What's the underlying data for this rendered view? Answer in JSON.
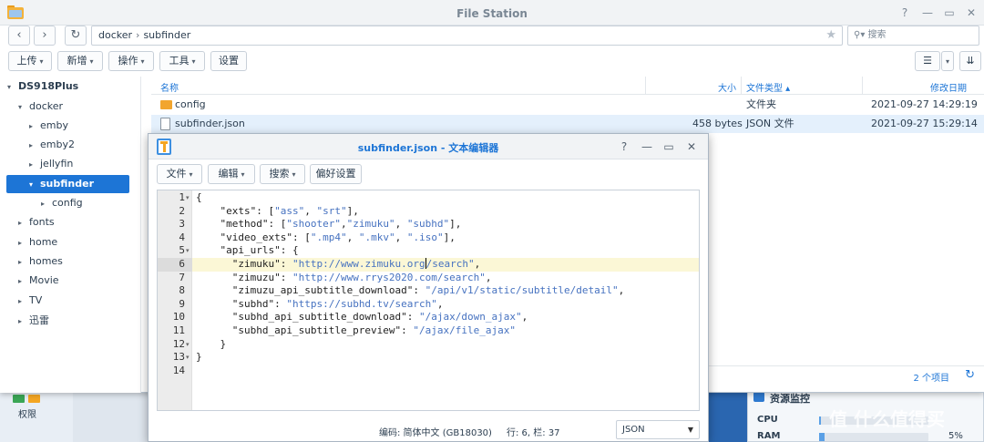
{
  "desktop": {
    "permission_label": "权限",
    "widget_title": "资源监控",
    "cpu_label": "CPU",
    "ram_label": "RAM",
    "cpu_percent": 2,
    "ram_percent": "5%",
    "ram_fill": 5,
    "watermark": "值 什么值得买"
  },
  "file_station": {
    "title": "File Station",
    "path": [
      "docker",
      "subfinder"
    ],
    "search_placeholder": "搜索",
    "toolbar": [
      {
        "label": "上传",
        "dropdown": true
      },
      {
        "label": "新增",
        "dropdown": true
      },
      {
        "label": "操作",
        "dropdown": true
      },
      {
        "label": "工具",
        "dropdown": true
      },
      {
        "label": "设置",
        "dropdown": false
      }
    ],
    "tree": [
      {
        "label": "DS918Plus",
        "level": 0,
        "arrow": "▾"
      },
      {
        "label": "docker",
        "level": 1,
        "arrow": "▾"
      },
      {
        "label": "emby",
        "level": 2,
        "arrow": "▸"
      },
      {
        "label": "emby2",
        "level": 2,
        "arrow": "▸"
      },
      {
        "label": "jellyfin",
        "level": 2,
        "arrow": "▸"
      },
      {
        "label": "subfinder",
        "level": 2,
        "arrow": "▾",
        "selected": true
      },
      {
        "label": "config",
        "level": 3,
        "arrow": "▸"
      },
      {
        "label": "fonts",
        "level": 1,
        "arrow": "▸"
      },
      {
        "label": "home",
        "level": 1,
        "arrow": "▸"
      },
      {
        "label": "homes",
        "level": 1,
        "arrow": "▸"
      },
      {
        "label": "Movie",
        "level": 1,
        "arrow": "▸"
      },
      {
        "label": "TV",
        "level": 1,
        "arrow": "▸"
      },
      {
        "label": "迅雷",
        "level": 1,
        "arrow": "▸"
      }
    ],
    "columns": {
      "name": "名称",
      "size": "大小",
      "type": "文件类型 ▴",
      "modified": "修改日期"
    },
    "files": [
      {
        "name": "config",
        "size": "",
        "type": "文件夹",
        "modified": "2021-09-27 14:29:19",
        "kind": "folder"
      },
      {
        "name": "subfinder.json",
        "size": "458 bytes",
        "type": "JSON 文件",
        "modified": "2021-09-27 15:29:14",
        "kind": "file"
      }
    ],
    "item_count": "2 个项目"
  },
  "editor": {
    "title": "subfinder.json - 文本编辑器",
    "toolbar": [
      {
        "label": "文件",
        "dropdown": true
      },
      {
        "label": "编辑",
        "dropdown": true
      },
      {
        "label": "搜索",
        "dropdown": true
      },
      {
        "label": "偏好设置",
        "dropdown": false
      }
    ],
    "line_numbers": [
      "1",
      "2",
      "3",
      "4",
      "5",
      "6",
      "7",
      "8",
      "9",
      "10",
      "11",
      "12",
      "13",
      "14"
    ],
    "foldable_lines": [
      1,
      5,
      12,
      13
    ],
    "current_line": 6,
    "lines": [
      [
        {
          "t": "{",
          "c": "k"
        }
      ],
      [
        {
          "t": "    \"exts\": [",
          "c": "k"
        },
        {
          "t": "\"ass\"",
          "c": "s"
        },
        {
          "t": ", ",
          "c": "k"
        },
        {
          "t": "\"srt\"",
          "c": "s"
        },
        {
          "t": "],",
          "c": "k"
        }
      ],
      [
        {
          "t": "    \"method\": [",
          "c": "k"
        },
        {
          "t": "\"shooter\"",
          "c": "s"
        },
        {
          "t": ",",
          "c": "k"
        },
        {
          "t": "\"zimuku\"",
          "c": "s"
        },
        {
          "t": ", ",
          "c": "k"
        },
        {
          "t": "\"subhd\"",
          "c": "s"
        },
        {
          "t": "],",
          "c": "k"
        }
      ],
      [
        {
          "t": "    \"video_exts\": [",
          "c": "k"
        },
        {
          "t": "\".mp4\"",
          "c": "s"
        },
        {
          "t": ", ",
          "c": "k"
        },
        {
          "t": "\".mkv\"",
          "c": "s"
        },
        {
          "t": ", ",
          "c": "k"
        },
        {
          "t": "\".iso\"",
          "c": "s"
        },
        {
          "t": "],",
          "c": "k"
        }
      ],
      [
        {
          "t": "    \"api_urls\": {",
          "c": "k"
        }
      ],
      [
        {
          "t": "      \"zimuku\": ",
          "c": "k"
        },
        {
          "t": "\"http://www.zimuku.org",
          "c": "s"
        },
        {
          "t": "|",
          "c": "cursor"
        },
        {
          "t": "/search\"",
          "c": "s"
        },
        {
          "t": ",",
          "c": "k"
        }
      ],
      [
        {
          "t": "      \"zimuzu\": ",
          "c": "k"
        },
        {
          "t": "\"http://www.rrys2020.com/search\"",
          "c": "s"
        },
        {
          "t": ",",
          "c": "k"
        }
      ],
      [
        {
          "t": "      \"zimuzu_api_subtitle_download\": ",
          "c": "k"
        },
        {
          "t": "\"/api/v1/static/subtitle/detail\"",
          "c": "s"
        },
        {
          "t": ",",
          "c": "k"
        }
      ],
      [
        {
          "t": "      \"subhd\": ",
          "c": "k"
        },
        {
          "t": "\"https://subhd.tv/search\"",
          "c": "s"
        },
        {
          "t": ",",
          "c": "k"
        }
      ],
      [
        {
          "t": "      \"subhd_api_subtitle_download\": ",
          "c": "k"
        },
        {
          "t": "\"/ajax/down_ajax\"",
          "c": "s"
        },
        {
          "t": ",",
          "c": "k"
        }
      ],
      [
        {
          "t": "      \"subhd_api_subtitle_preview\": ",
          "c": "k"
        },
        {
          "t": "\"/ajax/file_ajax\"",
          "c": "s"
        }
      ],
      [
        {
          "t": "    }",
          "c": "k"
        }
      ],
      [
        {
          "t": "}",
          "c": "k"
        }
      ],
      [
        {
          "t": "",
          "c": "k"
        }
      ]
    ],
    "encoding": "编码: 简体中文 (GB18030)",
    "position": "行: 6, 栏: 37",
    "language": "JSON"
  }
}
